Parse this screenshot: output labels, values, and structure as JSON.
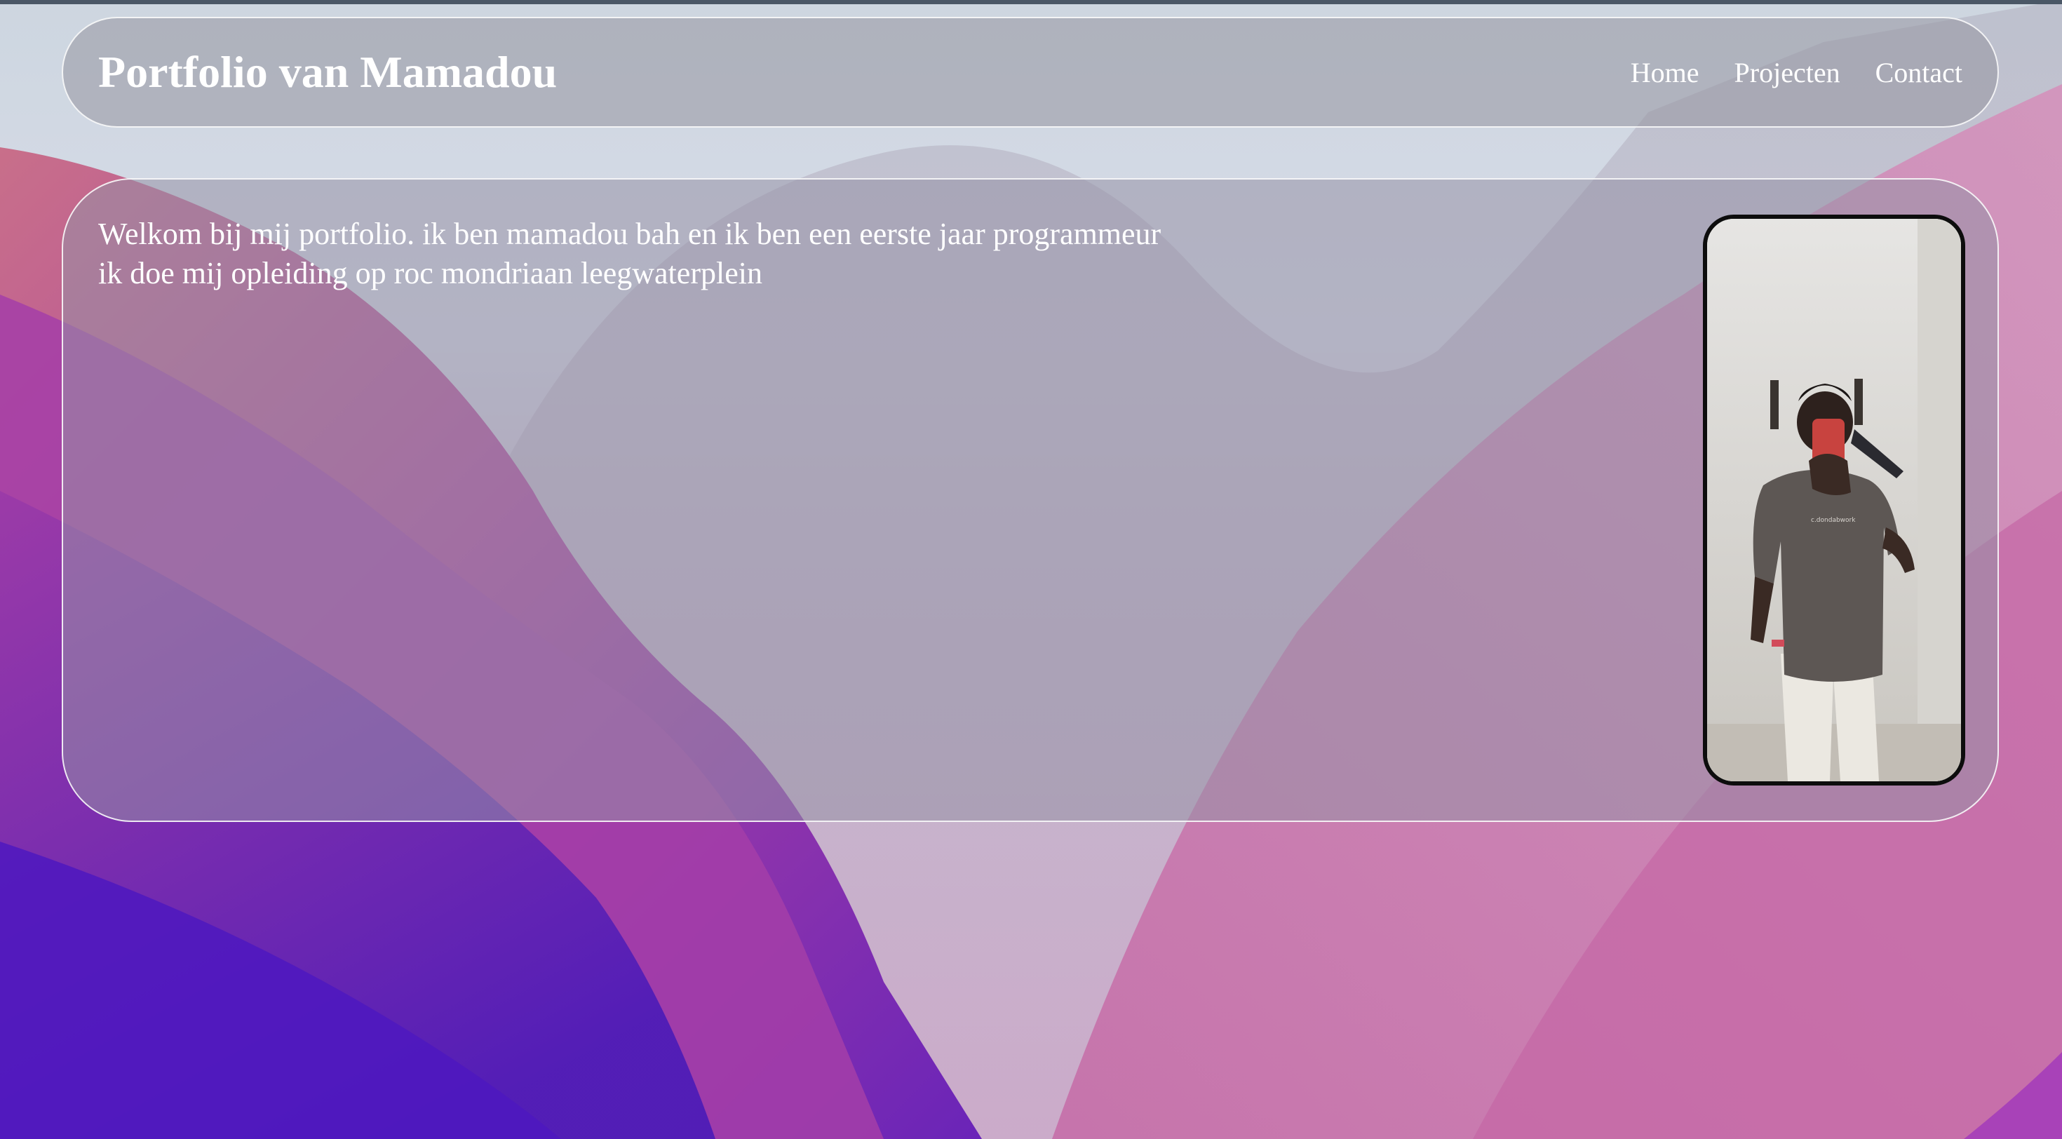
{
  "header": {
    "title": "Portfolio van Mamadou",
    "nav": [
      {
        "label": "Home"
      },
      {
        "label": "Projecten"
      },
      {
        "label": "Contact"
      }
    ]
  },
  "main": {
    "intro_lines": [
      "Welkom bij mij portfolio. ik ben mamadou bah en ik ben een eerste jaar programmeur",
      "ik doe mij opleiding op roc mondriaan leegwaterplein"
    ],
    "photo": {
      "description_icon": "profile-photo"
    }
  },
  "colors": {
    "topline": "#4a5766",
    "text": "#ffffff",
    "frame_border": "#0d0d0d"
  }
}
